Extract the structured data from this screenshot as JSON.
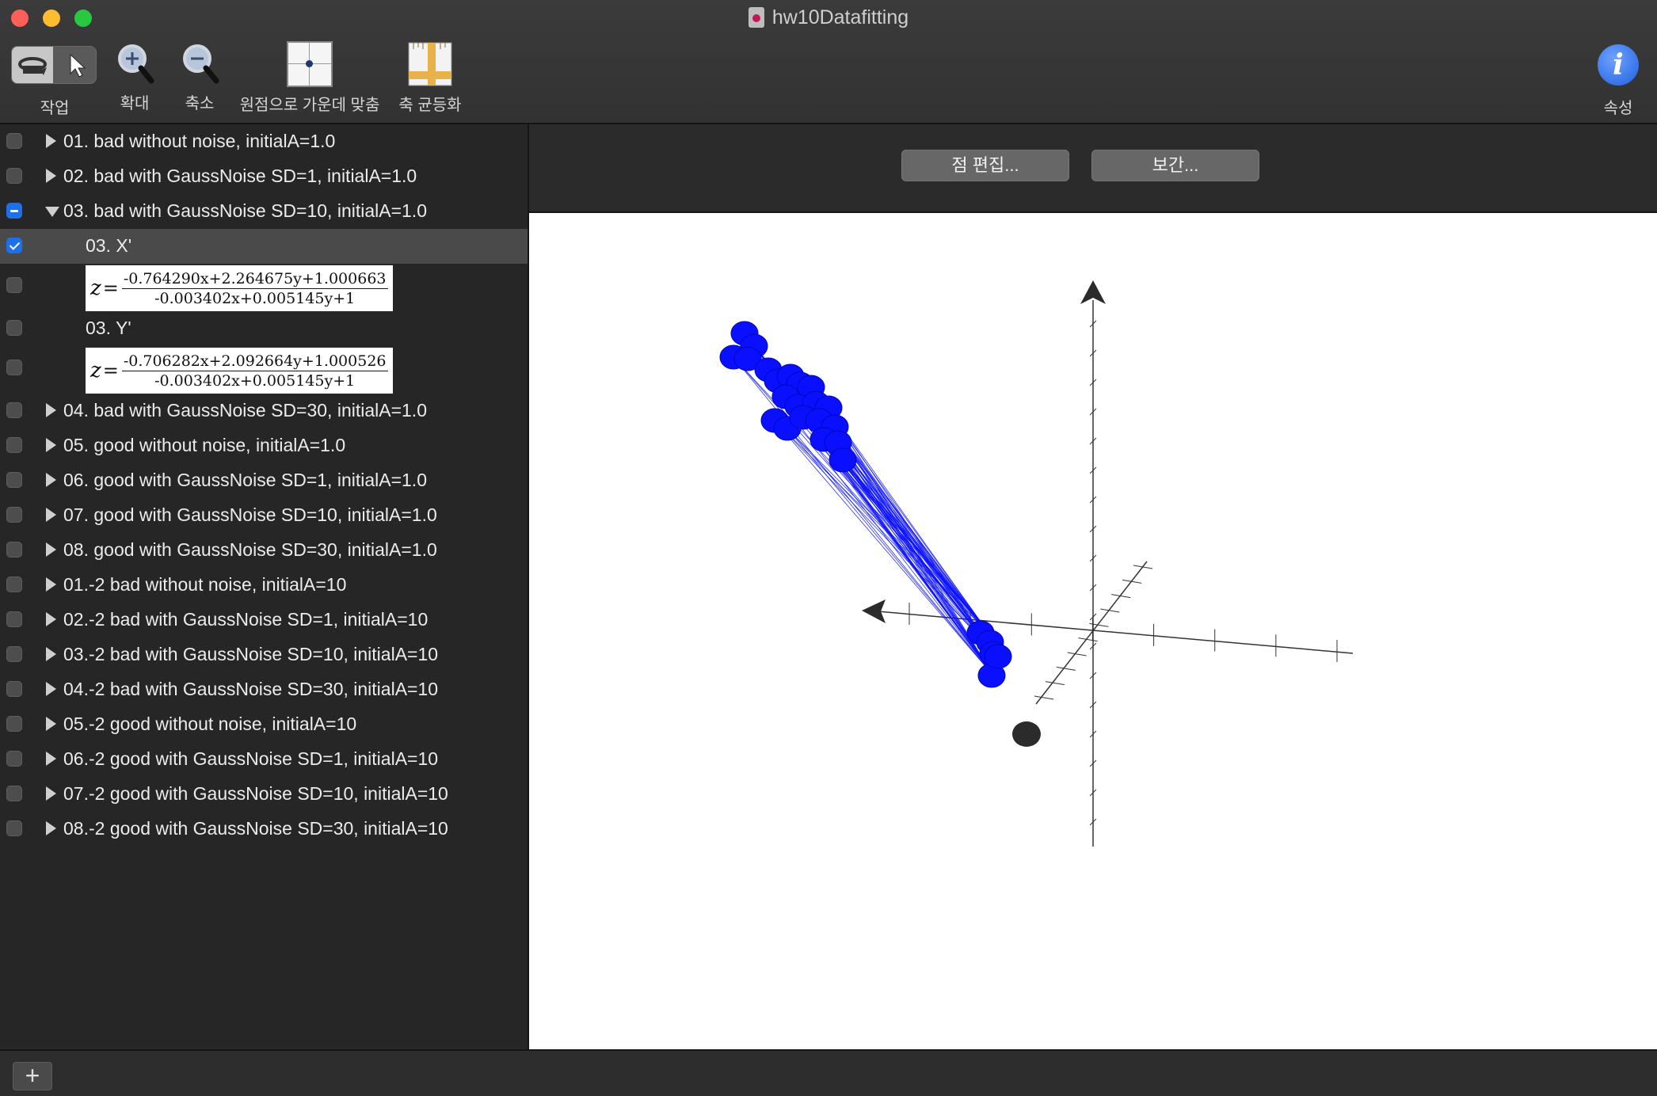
{
  "window": {
    "title": "hw10Datafitting"
  },
  "toolbar": {
    "action_label": "작업",
    "zoom_in_label": "확대",
    "zoom_out_label": "축소",
    "center_origin_label": "원점으로 가운데 맞춤",
    "equalize_axes_label": "축 균등화",
    "properties_label": "속성",
    "info_glyph": "i"
  },
  "sidebar": {
    "items": [
      {
        "label": "01. bad without noise, initialA=1.0",
        "expanded": false,
        "checked": "off"
      },
      {
        "label": "02. bad with GaussNoise SD=1, initialA=1.0",
        "expanded": false,
        "checked": "off"
      },
      {
        "label": "03. bad with GaussNoise SD=10, initialA=1.0",
        "expanded": true,
        "checked": "mixed"
      },
      {
        "label": "03. X'",
        "child": true,
        "checked": "on",
        "selected": true
      },
      {
        "formula_numerator": "-0.764290x+2.264675y+1.000663",
        "formula_denominator": "-0.003402x+0.005145y+1"
      },
      {
        "label": "03. Y'",
        "child": true,
        "checked": "off"
      },
      {
        "formula_numerator": "-0.706282x+2.092664y+1.000526",
        "formula_denominator": "-0.003402x+0.005145y+1"
      },
      {
        "label": "04. bad with GaussNoise SD=30, initialA=1.0",
        "expanded": false,
        "checked": "off"
      },
      {
        "label": "05. good without noise, initialA=1.0",
        "expanded": false,
        "checked": "off"
      },
      {
        "label": "06. good with GaussNoise SD=1, initialA=1.0",
        "expanded": false,
        "checked": "off"
      },
      {
        "label": "07. good with GaussNoise SD=10, initialA=1.0",
        "expanded": false,
        "checked": "off"
      },
      {
        "label": "08. good with GaussNoise SD=30, initialA=1.0",
        "expanded": false,
        "checked": "off"
      },
      {
        "label": "01.-2 bad without noise, initialA=10",
        "expanded": false,
        "checked": "off"
      },
      {
        "label": "02.-2 bad with GaussNoise SD=1, initialA=10",
        "expanded": false,
        "checked": "off"
      },
      {
        "label": "03.-2 bad with GaussNoise SD=10, initialA=10",
        "expanded": false,
        "checked": "off"
      },
      {
        "label": "04.-2 bad with GaussNoise SD=30, initialA=10",
        "expanded": false,
        "checked": "off"
      },
      {
        "label": "05.-2 good without noise, initialA=10",
        "expanded": false,
        "checked": "off"
      },
      {
        "label": "06.-2 good with GaussNoise SD=1, initialA=10",
        "expanded": false,
        "checked": "off"
      },
      {
        "label": "07.-2 good with GaussNoise SD=10, initialA=10",
        "expanded": false,
        "checked": "off"
      },
      {
        "label": "08.-2 good with GaussNoise SD=30, initialA=10",
        "expanded": false,
        "checked": "off"
      }
    ],
    "formula_lhs": "z",
    "formula_eq": "="
  },
  "pane": {
    "edit_points_label": "점 편집...",
    "interpolate_label": "보간..."
  },
  "bottom": {
    "add_glyph": "+"
  },
  "colors": {
    "point": "#0a10ff",
    "axis": "#333333",
    "accent": "#1f6feb"
  }
}
